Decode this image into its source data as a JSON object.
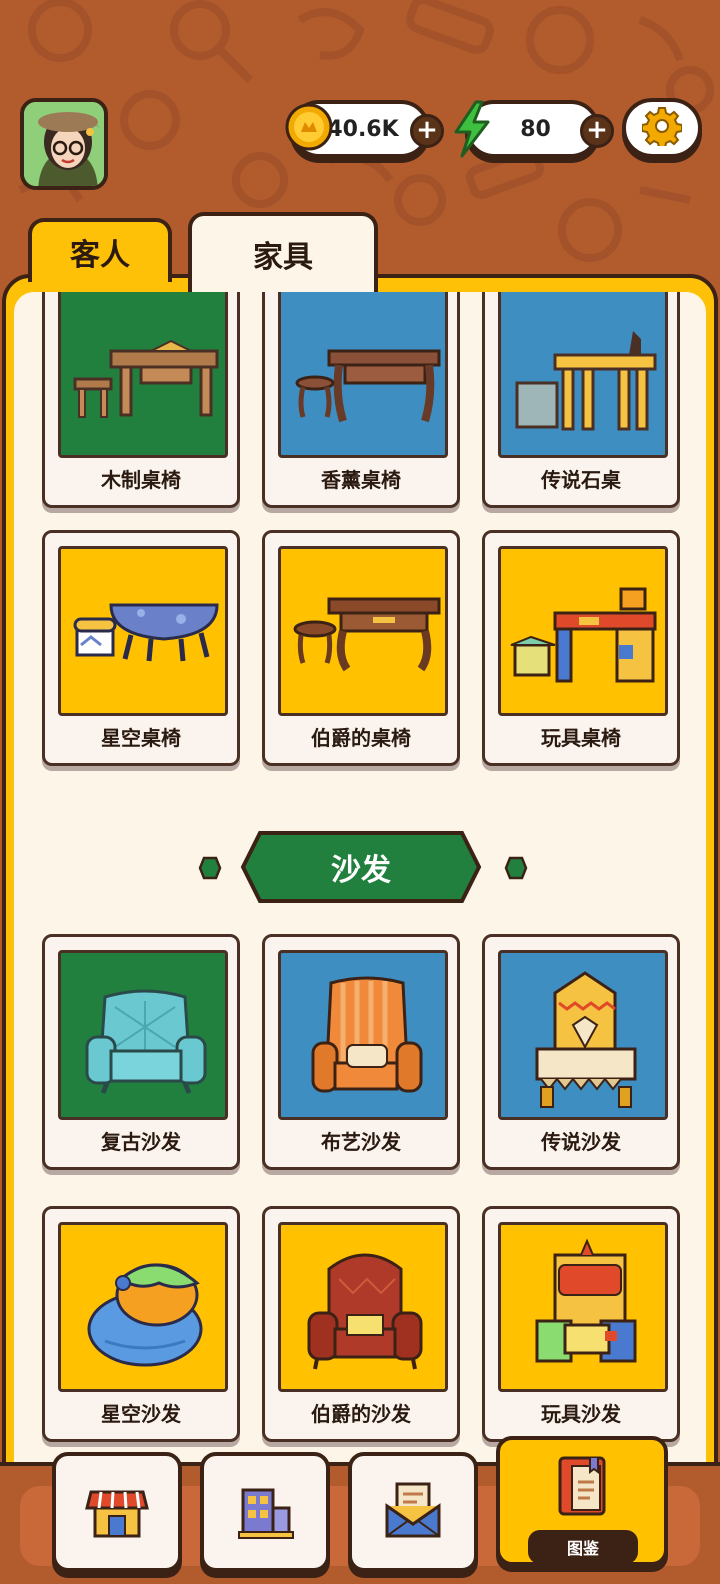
{
  "header": {
    "coins": "40.6K",
    "energy": "80",
    "coin_icon": "coin-icon",
    "energy_icon": "lightning-icon",
    "settings_icon": "gear-icon"
  },
  "tabs": [
    {
      "label": "客人",
      "active": false
    },
    {
      "label": "家具",
      "active": true
    }
  ],
  "furniture": {
    "row1": [
      {
        "name": "木制桌椅",
        "bg": "#22803f"
      },
      {
        "name": "香薰桌椅",
        "bg": "#3f8ec2"
      },
      {
        "name": "传说石桌",
        "bg": "#3f8ec2"
      }
    ],
    "row2": [
      {
        "name": "星空桌椅",
        "bg": "#ffc100"
      },
      {
        "name": "伯爵的桌椅",
        "bg": "#ffc100"
      },
      {
        "name": "玩具桌椅",
        "bg": "#ffc100"
      }
    ],
    "section_title": "沙发",
    "row3": [
      {
        "name": "复古沙发",
        "bg": "#22803f"
      },
      {
        "name": "布艺沙发",
        "bg": "#3f8ec2"
      },
      {
        "name": "传说沙发",
        "bg": "#3f8ec2"
      }
    ],
    "row4": [
      {
        "name": "星空沙发",
        "bg": "#ffc100"
      },
      {
        "name": "伯爵的沙发",
        "bg": "#ffc100"
      },
      {
        "name": "玩具沙发",
        "bg": "#ffc100"
      }
    ]
  },
  "bottom_nav": {
    "catalog_label": "图鉴",
    "icons": [
      "shop-icon",
      "building-icon",
      "mail-icon",
      "catalog-book-icon"
    ]
  },
  "colors": {
    "brown": "#b25c2e",
    "yellow": "#ffc107",
    "green": "#22803f",
    "blue": "#3f8ec2",
    "cream": "#fdf6e8",
    "outline": "#3b2215"
  }
}
